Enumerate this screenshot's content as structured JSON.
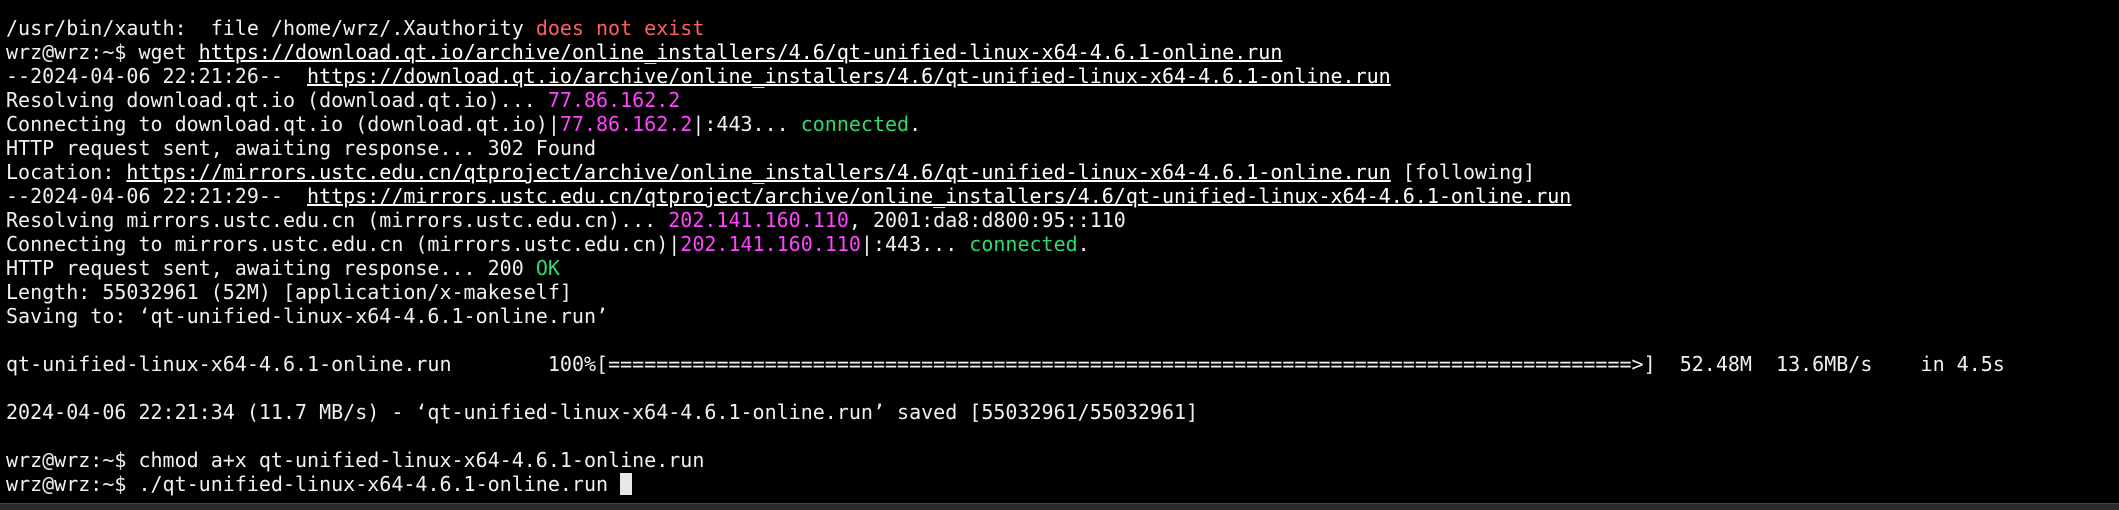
{
  "lines": {
    "l1": {
      "a": "/usr/bin/xauth:  file /home/wrz/.Xauthority ",
      "b": "does not exist"
    },
    "l2": {
      "prompt": "wrz@wrz:~$ ",
      "cmd": "wget ",
      "url": "https://download.qt.io/archive/online_installers/4.6/qt-unified-linux-x64-4.6.1-online.run"
    },
    "l3": {
      "a": "--2024-04-06 22:21:26--  ",
      "url": "https://download.qt.io/archive/online_installers/4.6/qt-unified-linux-x64-4.6.1-online.run"
    },
    "l4": {
      "a": "Resolving download.qt.io (download.qt.io)... ",
      "ip": "77.86.162.2"
    },
    "l5": {
      "a": "Connecting to download.qt.io (download.qt.io)|",
      "ip": "77.86.162.2",
      "b": "|:443... ",
      "status": "connected",
      "c": "."
    },
    "l6": {
      "a": "HTTP request sent, awaiting response... 302 Found"
    },
    "l7": {
      "a": "Location: ",
      "url": "https://mirrors.ustc.edu.cn/qtproject/archive/online_installers/4.6/qt-unified-linux-x64-4.6.1-online.run",
      "b": " [following]"
    },
    "l8": {
      "a": "--2024-04-06 22:21:29--  ",
      "url": "https://mirrors.ustc.edu.cn/qtproject/archive/online_installers/4.6/qt-unified-linux-x64-4.6.1-online.run"
    },
    "l9": {
      "a": "Resolving mirrors.ustc.edu.cn (mirrors.ustc.edu.cn)... ",
      "ip": "202.141.160.110",
      "b": ", 2001:da8:d800:95::110"
    },
    "l10": {
      "a": "Connecting to mirrors.ustc.edu.cn (mirrors.ustc.edu.cn)|",
      "ip": "202.141.160.110",
      "b": "|:443... ",
      "status": "connected",
      "c": "."
    },
    "l11": {
      "a": "HTTP request sent, awaiting response... 200 ",
      "status": "OK"
    },
    "l12": {
      "a": "Length: 55032961 (52M) [application/x-makeself]"
    },
    "l13": {
      "a": "Saving to: ‘qt-unified-linux-x64-4.6.1-online.run’"
    },
    "progress": {
      "file": "qt-unified-linux-x64-4.6.1-online.run",
      "gap": "        ",
      "percent": "100%",
      "bar": "[=====================================================================================>]",
      "size": "  52.48M",
      "speed": "  13.6MB/s",
      "eta": "    in 4.5s"
    },
    "l15": {
      "a": "2024-04-06 22:21:34 (11.7 MB/s) - ‘qt-unified-linux-x64-4.6.1-online.run’ saved [55032961/55032961]"
    },
    "l16": {
      "prompt": "wrz@wrz:~$ ",
      "cmd": "chmod a+x qt-unified-linux-x64-4.6.1-online.run"
    },
    "l17": {
      "prompt": "wrz@wrz:~$ ",
      "cmd": "./qt-unified-linux-x64-4.6.1-online.run "
    }
  },
  "colors": {
    "background": "#000000",
    "text": "#f0f0f0",
    "error": "#ff5f5f",
    "ip": "#ff44ff",
    "success": "#2edb6a"
  }
}
